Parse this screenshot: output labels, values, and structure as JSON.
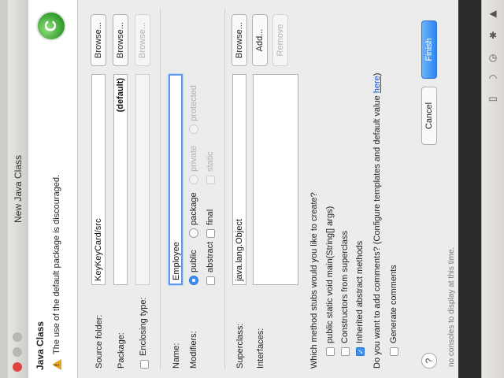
{
  "window": {
    "title": "New Java Class"
  },
  "header": {
    "title": "Java Class",
    "message": "The use of the default package is discouraged.",
    "warning_icon": "warning-triangle-icon",
    "logo_icon": "new-class-wizard-icon",
    "logo_letter": "C"
  },
  "form": {
    "source_folder": {
      "label": "Source folder:",
      "value": "KeyKeyCard/src",
      "button": "Browse..."
    },
    "package": {
      "label": "Package:",
      "value": "",
      "placeholder": "(default)",
      "button": "Browse..."
    },
    "enclosing_type": {
      "label": "Enclosing type:",
      "checked": false,
      "value": "",
      "button": "Browse..."
    },
    "name": {
      "label": "Name:",
      "value": "Employee"
    },
    "modifiers": {
      "label": "Modifiers:",
      "visibility": [
        {
          "label": "public",
          "selected": true,
          "enabled": true
        },
        {
          "label": "package",
          "selected": false,
          "enabled": true
        },
        {
          "label": "private",
          "selected": false,
          "enabled": false
        },
        {
          "label": "protected",
          "selected": false,
          "enabled": false
        }
      ],
      "flags": [
        {
          "label": "abstract",
          "checked": false,
          "enabled": true
        },
        {
          "label": "final",
          "checked": false,
          "enabled": true
        },
        {
          "label": "static",
          "checked": false,
          "enabled": false
        }
      ]
    },
    "superclass": {
      "label": "Superclass:",
      "value": "java.lang.Object",
      "button": "Browse..."
    },
    "interfaces": {
      "label": "Interfaces:",
      "add_button": "Add...",
      "remove_button": "Remove"
    },
    "stubs": {
      "question": "Which method stubs would you like to create?",
      "options": [
        {
          "label": "public static void main(String[] args)",
          "checked": false
        },
        {
          "label": "Constructors from superclass",
          "checked": false
        },
        {
          "label": "Inherited abstract methods",
          "checked": true
        }
      ]
    },
    "comments": {
      "question": "Do you want to add comments? (Configure templates and default value ",
      "link": "here",
      "question_end": ")",
      "option": {
        "label": "Generate comments",
        "checked": false
      }
    }
  },
  "footer": {
    "help_label": "?",
    "cancel": "Cancel",
    "finish": "Finish",
    "background_text": "no consoles to display at this time."
  },
  "colors": {
    "accent": "#3d8ff0",
    "warning": "#e8a21a",
    "close": "#e0443e"
  }
}
